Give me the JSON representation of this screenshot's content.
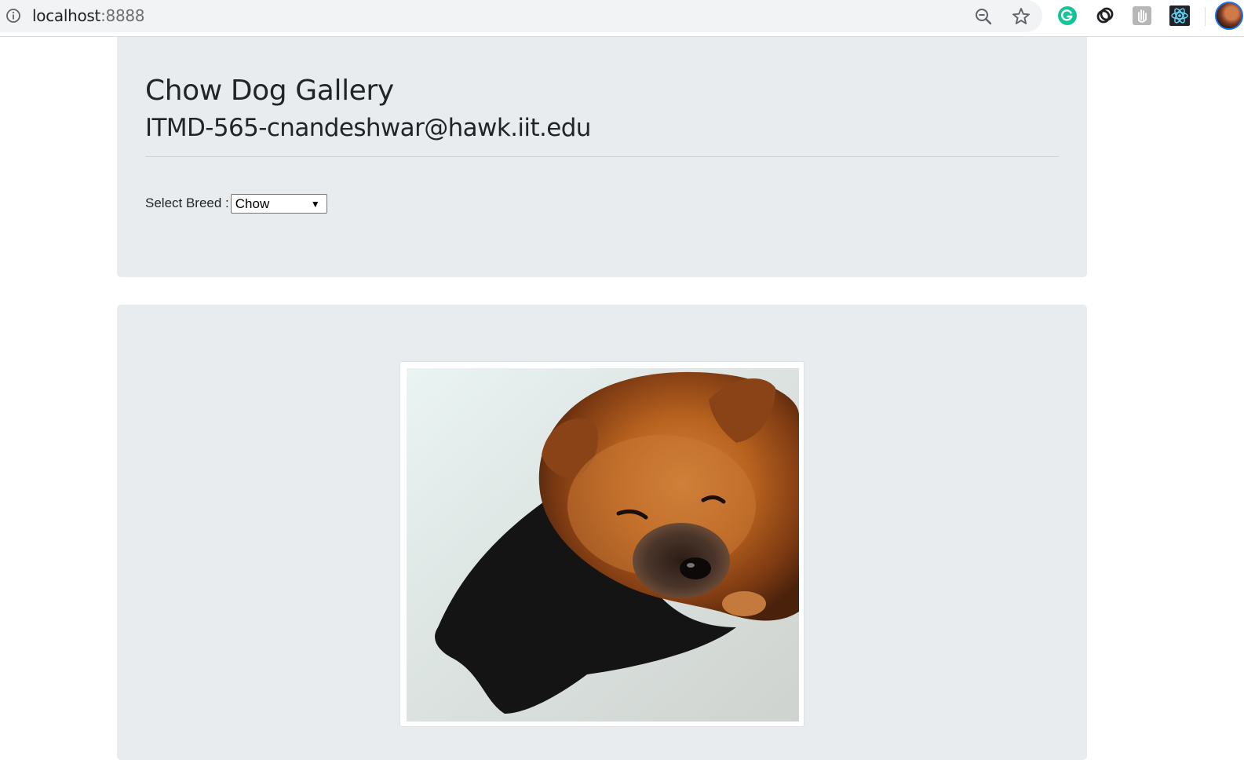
{
  "browser": {
    "url_host": "localhost",
    "url_port": ":8888",
    "icons": [
      "info-icon",
      "zoom-out-icon",
      "bookmark-star-icon",
      "grammarly-extension-icon",
      "link-extension-icon",
      "hand-extension-icon",
      "react-devtools-icon",
      "profile-avatar"
    ]
  },
  "header": {
    "title": "Chow Dog Gallery",
    "subtitle": "ITMD-565-cnandeshwar@hawk.iit.edu"
  },
  "breed_selector": {
    "label": "Select Breed :",
    "selected": "Chow"
  },
  "gallery": {
    "image_subject": "chow-chow-puppy-photo"
  }
}
